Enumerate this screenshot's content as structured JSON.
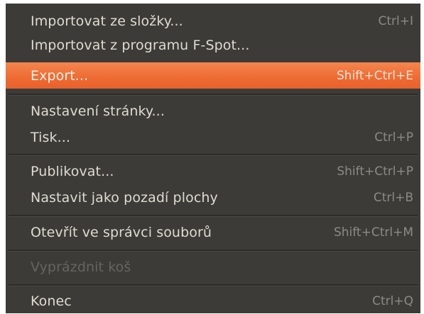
{
  "menu": {
    "items": [
      {
        "label": "Importovat ze složky...",
        "shortcut": "Ctrl+I"
      },
      {
        "label": "Importovat z programu F-Spot...",
        "shortcut": ""
      },
      {
        "label": "Export...",
        "shortcut": "Shift+Ctrl+E",
        "highlighted": true
      },
      {
        "label": "Nastavení stránky...",
        "shortcut": ""
      },
      {
        "label": "Tisk...",
        "shortcut": "Ctrl+P"
      },
      {
        "label": "Publikovat...",
        "shortcut": "Shift+Ctrl+P"
      },
      {
        "label": "Nastavit jako pozadí plochy",
        "shortcut": "Ctrl+B"
      },
      {
        "label": "Otevřít ve správci souborů",
        "shortcut": "Shift+Ctrl+M"
      },
      {
        "label": "Vyprázdnit koš",
        "shortcut": "",
        "disabled": true
      },
      {
        "label": "Konec",
        "shortcut": "Ctrl+Q"
      }
    ]
  },
  "colors": {
    "menu_background": "#3c3b37",
    "highlight": "#f07746",
    "text": "#dfdbd2",
    "shortcut_text": "#8c8a85",
    "disabled_text": "#66645f"
  }
}
